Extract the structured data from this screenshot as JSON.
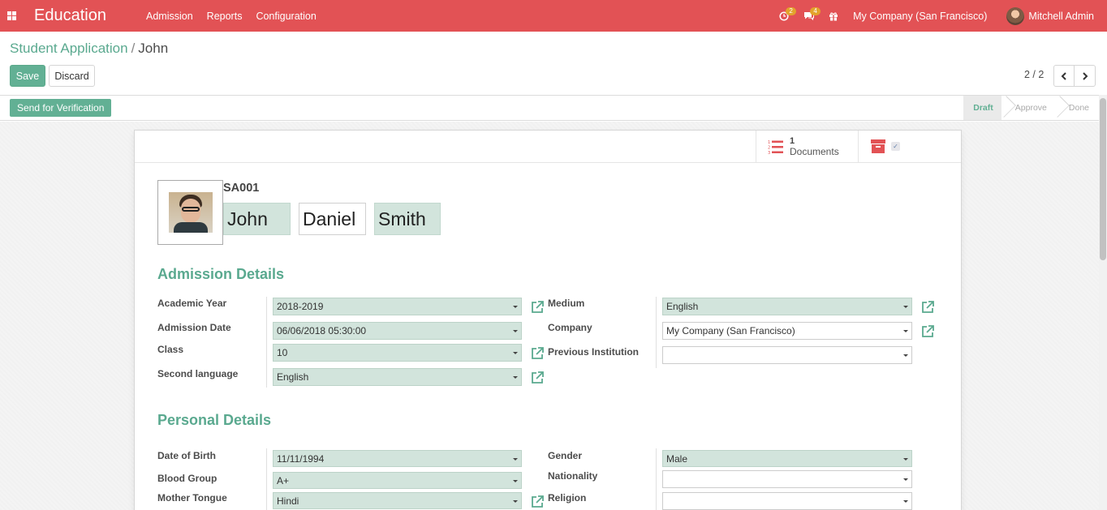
{
  "navbar": {
    "brand": "Education",
    "menu": [
      "Admission",
      "Reports",
      "Configuration"
    ],
    "activity_count": "2",
    "message_count": "4",
    "company": "My Company (San Francisco)",
    "user": "Mitchell Admin",
    "color": "#e25255"
  },
  "breadcrumb": {
    "parent": "Student Application",
    "sep": "/",
    "current": "John"
  },
  "toolbar": {
    "save_label": "Save",
    "discard_label": "Discard"
  },
  "pager": {
    "value": "2 / 2"
  },
  "statusbar": {
    "action_label": "Send for Verification",
    "stages": [
      "Draft",
      "Approve",
      "Done"
    ],
    "active_stage": "Draft"
  },
  "smart_buttons": {
    "documents_count": "1",
    "documents_label": "Documents"
  },
  "student": {
    "code": "SA001",
    "first_name": "John",
    "middle_name": "Daniel",
    "last_name": "Smith"
  },
  "admission": {
    "title": "Admission Details",
    "academic_year_label": "Academic Year",
    "academic_year": "2018-2019",
    "admission_date_label": "Admission Date",
    "admission_date": "06/06/2018 05:30:00",
    "class_label": "Class",
    "class": "10",
    "second_language_label": "Second language",
    "second_language": "English",
    "medium_label": "Medium",
    "medium": "English",
    "company_label": "Company",
    "company": "My Company (San Francisco)",
    "previous_institution_label": "Previous Institution",
    "previous_institution": ""
  },
  "personal": {
    "title": "Personal Details",
    "dob_label": "Date of Birth",
    "dob": "11/11/1994",
    "blood_group_label": "Blood Group",
    "blood_group": "A+",
    "mother_tongue_label": "Mother Tongue",
    "mother_tongue": "Hindi",
    "gender_label": "Gender",
    "gender": "Male",
    "nationality_label": "Nationality",
    "nationality": "",
    "religion_label": "Religion",
    "religion": ""
  },
  "colors": {
    "accent": "#5aa98f",
    "required_bg": "#d2e4dc",
    "primary_button": "#62b094"
  }
}
